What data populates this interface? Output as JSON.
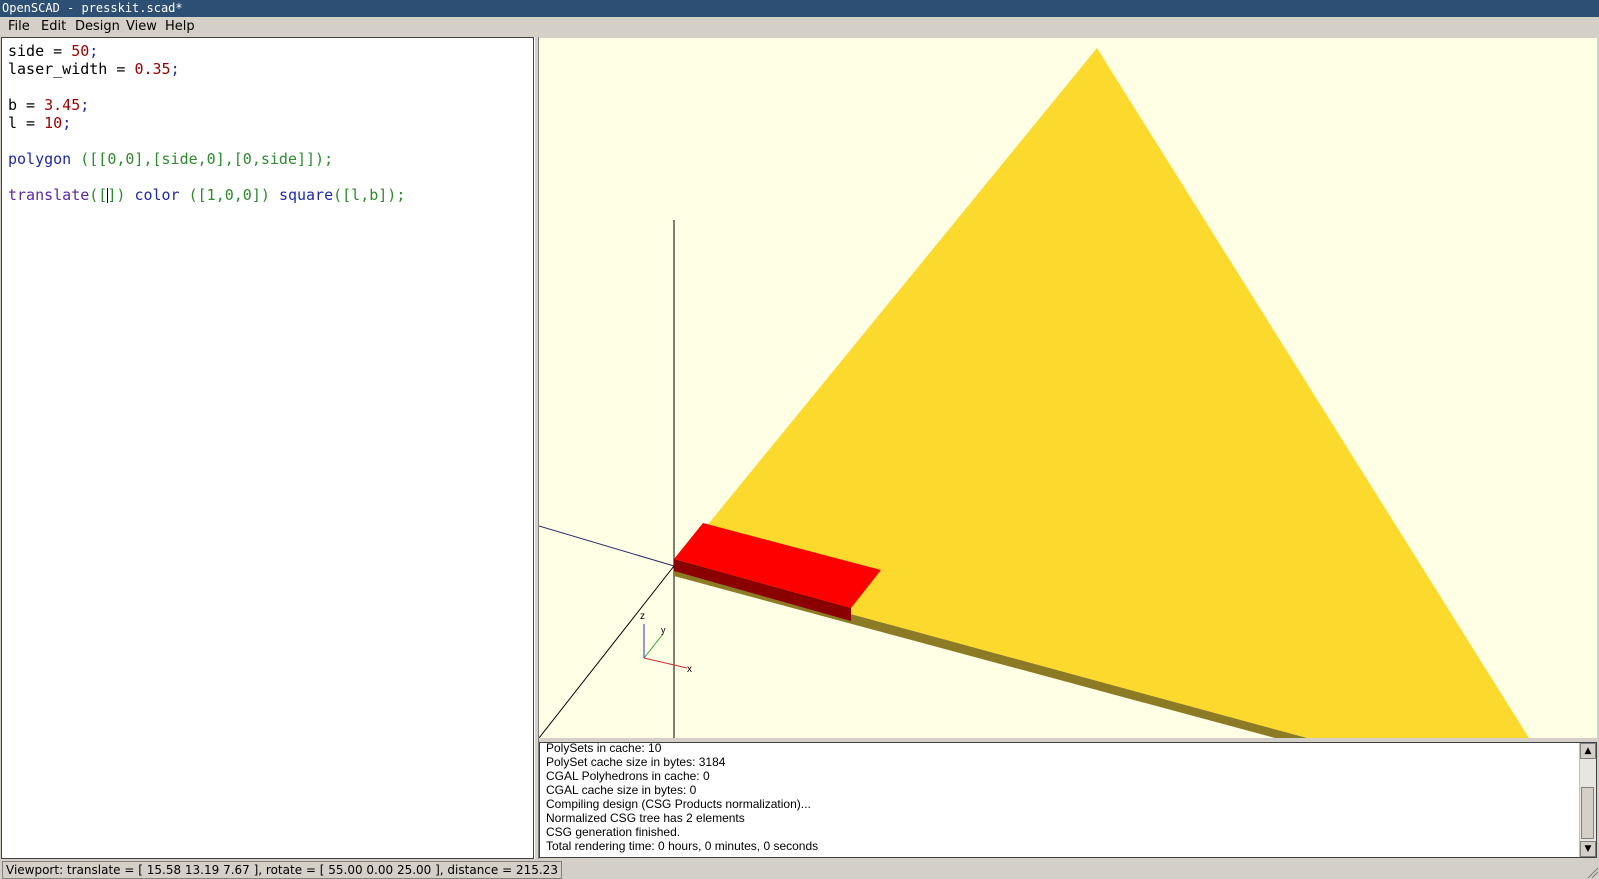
{
  "window": {
    "title": "OpenSCAD - presskit.scad*"
  },
  "menu": {
    "file": "File",
    "edit": "Edit",
    "design": "Design",
    "view": "View",
    "help": "Help"
  },
  "editor": {
    "line1": {
      "name": "side",
      "op": " = ",
      "value": "50",
      "end": ";"
    },
    "line2": {
      "name": "laser_width",
      "op": " = ",
      "value": "0.35",
      "end": ";"
    },
    "line4": {
      "name": "b",
      "op": " = ",
      "value": "3.45",
      "end": ";"
    },
    "line5": {
      "name": "l",
      "op": " = ",
      "value": "10",
      "end": ";"
    },
    "line7": {
      "kw": "polygon",
      "rest": " ([[0,0],[side,0],[0,side]]);"
    },
    "line9": {
      "kw1": "translate",
      "mid1": "([",
      "mid2": "]) ",
      "kw2": "color",
      "mid3": " ([1,0,0]) ",
      "kw3": "square",
      "mid4": "([l,b]);"
    }
  },
  "viewport": {
    "background_color": "#ffffe5",
    "triangle_color": "#fbda2d",
    "square_color": "#ff0000",
    "axes_labels": {
      "x": "x",
      "y": "y",
      "z": "z"
    }
  },
  "console": {
    "lines": [
      "PolySets in cache: 10",
      "PolySet cache size in bytes: 3184",
      "CGAL Polyhedrons in cache: 0",
      "CGAL cache size in bytes: 0",
      "Compiling design (CSG Products normalization)...",
      "Normalized CSG tree has 2 elements",
      "CSG generation finished.",
      "Total rendering time: 0 hours, 0 minutes, 0 seconds"
    ]
  },
  "status": {
    "viewport_info": "Viewport: translate = [ 15.58 13.19 7.67 ], rotate = [ 55.00 0.00 25.00 ], distance = 215.23"
  }
}
